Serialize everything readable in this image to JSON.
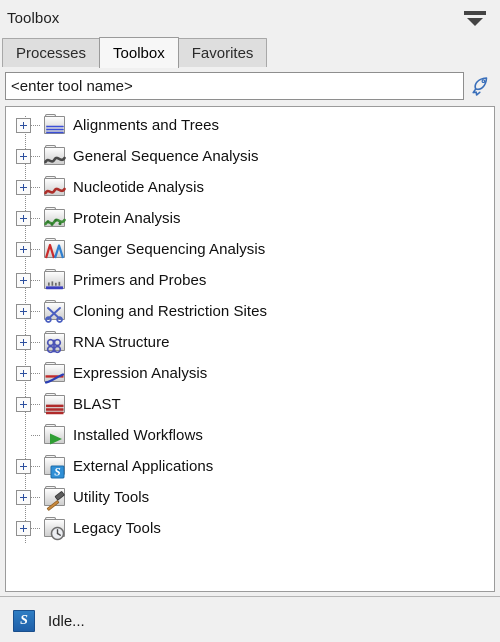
{
  "window": {
    "title": "Toolbox",
    "collapse_icon": "collapse-panel-icon"
  },
  "tabs": [
    {
      "label": "Processes",
      "active": false
    },
    {
      "label": "Toolbox",
      "active": true
    },
    {
      "label": "Favorites",
      "active": false
    }
  ],
  "search": {
    "placeholder": "<enter tool name>",
    "value": "",
    "button_icon": "rocket-icon"
  },
  "tree": {
    "items": [
      {
        "label": "Alignments and Trees",
        "icon": "folder-alignment-icon",
        "expandable": true
      },
      {
        "label": "General Sequence Analysis",
        "icon": "folder-sequence-icon",
        "expandable": true
      },
      {
        "label": "Nucleotide Analysis",
        "icon": "folder-nucleotide-icon",
        "expandable": true
      },
      {
        "label": "Protein Analysis",
        "icon": "folder-protein-icon",
        "expandable": true
      },
      {
        "label": "Sanger Sequencing Analysis",
        "icon": "folder-sanger-icon",
        "expandable": true
      },
      {
        "label": "Primers and Probes",
        "icon": "folder-primers-icon",
        "expandable": true
      },
      {
        "label": "Cloning and Restriction Sites",
        "icon": "folder-cloning-icon",
        "expandable": true
      },
      {
        "label": "RNA Structure",
        "icon": "folder-rna-icon",
        "expandable": true
      },
      {
        "label": "Expression Analysis",
        "icon": "folder-expression-icon",
        "expandable": true
      },
      {
        "label": "BLAST",
        "icon": "folder-blast-icon",
        "expandable": true
      },
      {
        "label": "Installed Workflows",
        "icon": "folder-workflow-icon",
        "expandable": false
      },
      {
        "label": "External Applications",
        "icon": "folder-external-icon",
        "expandable": true
      },
      {
        "label": "Utility Tools",
        "icon": "folder-utility-icon",
        "expandable": true
      },
      {
        "label": "Legacy Tools",
        "icon": "folder-legacy-icon",
        "expandable": true
      }
    ]
  },
  "statusbar": {
    "badge": "S",
    "badge_icon": "app-status-icon",
    "text": "Idle..."
  },
  "colors": {
    "panel_bg": "#f0f0f0",
    "tree_bg": "#ffffff",
    "border": "#9b9b9b",
    "accent_blue": "#2c4f9e",
    "badge_blue": "#1f5fa8",
    "text": "#101010"
  }
}
